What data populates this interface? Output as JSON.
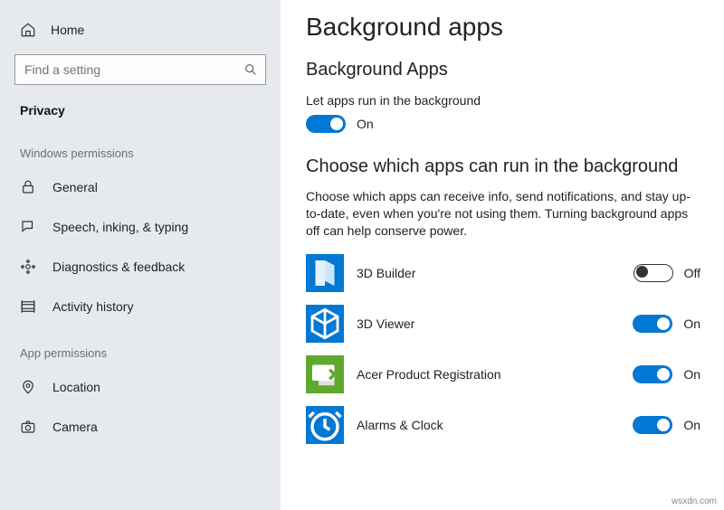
{
  "sidebar": {
    "home": "Home",
    "search_placeholder": "Find a setting",
    "section": "Privacy",
    "groups": [
      {
        "label": "Windows permissions",
        "items": [
          {
            "icon": "lock-icon",
            "label": "General"
          },
          {
            "icon": "speech-icon",
            "label": "Speech, inking, & typing"
          },
          {
            "icon": "diagnostics-icon",
            "label": "Diagnostics & feedback"
          },
          {
            "icon": "activity-icon",
            "label": "Activity history"
          }
        ]
      },
      {
        "label": "App permissions",
        "items": [
          {
            "icon": "location-icon",
            "label": "Location"
          },
          {
            "icon": "camera-icon",
            "label": "Camera"
          }
        ]
      }
    ]
  },
  "main": {
    "title": "Background apps",
    "subtitle": "Background Apps",
    "master_label": "Let apps run in the background",
    "master_state": "On",
    "choose_heading": "Choose which apps can run in the background",
    "choose_desc": "Choose which apps can receive info, send notifications, and stay up-to-date, even when you're not using them. Turning background apps off can help conserve power.",
    "apps": [
      {
        "name": "3D Builder",
        "state": "Off",
        "on": false,
        "cls": "ic-3db"
      },
      {
        "name": "3D Viewer",
        "state": "On",
        "on": true,
        "cls": "ic-3dv"
      },
      {
        "name": "Acer Product Registration",
        "state": "On",
        "on": true,
        "cls": "ic-acer"
      },
      {
        "name": "Alarms & Clock",
        "state": "On",
        "on": true,
        "cls": "ic-alarm"
      }
    ]
  },
  "watermark": "wsxdn.com"
}
